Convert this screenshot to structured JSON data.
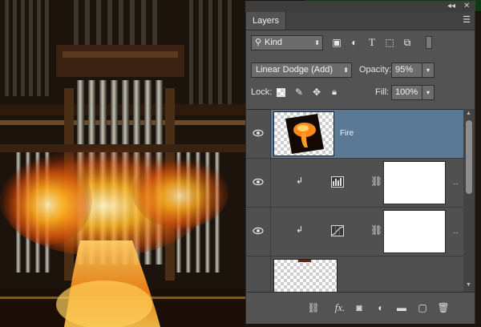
{
  "panel": {
    "tab_label": "Layers",
    "menu_icon": "panel-menu-icon",
    "collapse_icon": "collapse-icon",
    "close_icon": "close-icon"
  },
  "filter": {
    "kind_label": "Kind",
    "filter_icons": [
      "image-filter-icon",
      "adjustment-filter-icon",
      "type-filter-icon",
      "shape-filter-icon",
      "smart-object-filter-icon",
      "filter-toggle-icon"
    ]
  },
  "blend": {
    "mode": "Linear Dodge (Add)",
    "opacity_label": "Opacity:",
    "opacity_value": "95%"
  },
  "lock": {
    "lock_label": "Lock:",
    "lock_icons": [
      "lock-transparent-icon",
      "lock-image-icon",
      "lock-position-icon",
      "lock-all-icon"
    ],
    "fill_label": "Fill:",
    "fill_value": "100%"
  },
  "layers": [
    {
      "name": "Fire",
      "selected": true,
      "type": "image"
    },
    {
      "name": "",
      "selected": false,
      "type": "levels-adjustment",
      "clipped": true
    },
    {
      "name": "",
      "selected": false,
      "type": "curves-adjustment",
      "clipped": true
    },
    {
      "name": "",
      "selected": false,
      "type": "image"
    }
  ],
  "bottom_icons": [
    "link-layers-icon",
    "fx-icon",
    "add-mask-icon",
    "new-adjustment-icon",
    "new-group-icon",
    "new-layer-icon",
    "delete-icon"
  ],
  "colors": {
    "panel_bg": "#535353",
    "selected_layer": "#5a7995",
    "input_bg": "#6c6c6c"
  }
}
